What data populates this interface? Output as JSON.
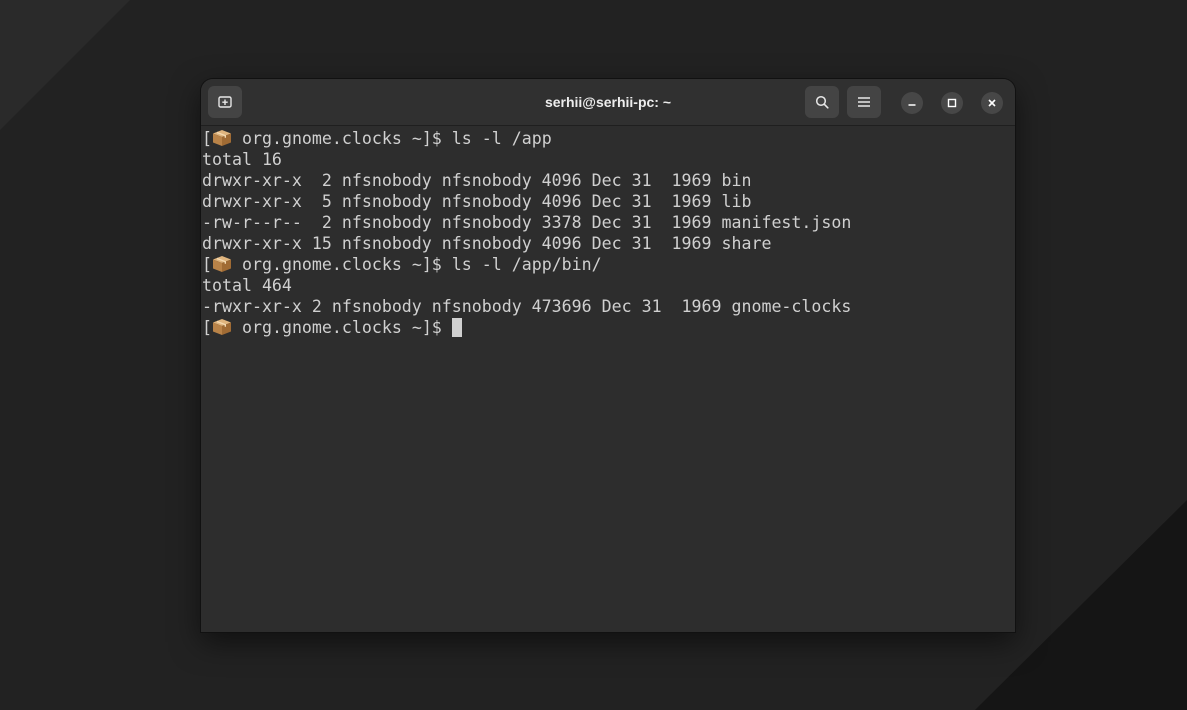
{
  "window": {
    "title": "serhii@serhii-pc: ~"
  },
  "headerbar": {
    "new_tab_icon": "new-tab-icon",
    "search_icon": "search-icon",
    "menu_icon": "hamburger-menu-icon",
    "minimize_icon": "minimize-icon",
    "maximize_icon": "maximize-icon",
    "close_icon": "close-icon"
  },
  "terminal": {
    "prompt_icon": "package-icon",
    "lines": [
      {
        "bracket": "[",
        "rest": " org.gnome.clocks ~]$ ls -l /app"
      },
      {
        "text": "total 16"
      },
      {
        "text": "drwxr-xr-x  2 nfsnobody nfsnobody 4096 Dec 31  1969 bin"
      },
      {
        "text": "drwxr-xr-x  5 nfsnobody nfsnobody 4096 Dec 31  1969 lib"
      },
      {
        "text": "-rw-r--r--  2 nfsnobody nfsnobody 3378 Dec 31  1969 manifest.json"
      },
      {
        "text": "drwxr-xr-x 15 nfsnobody nfsnobody 4096 Dec 31  1969 share"
      },
      {
        "bracket": "[",
        "rest": " org.gnome.clocks ~]$ ls -l /app/bin/"
      },
      {
        "text": "total 464"
      },
      {
        "text": "-rwxr-xr-x 2 nfsnobody nfsnobody 473696 Dec 31  1969 gnome-clocks"
      },
      {
        "bracket": "[",
        "rest": " org.gnome.clocks ~]$ "
      }
    ]
  },
  "colors": {
    "background": "#222222",
    "window": "#2d2d2d",
    "text": "#d0d0d0",
    "title": "#ededed"
  }
}
